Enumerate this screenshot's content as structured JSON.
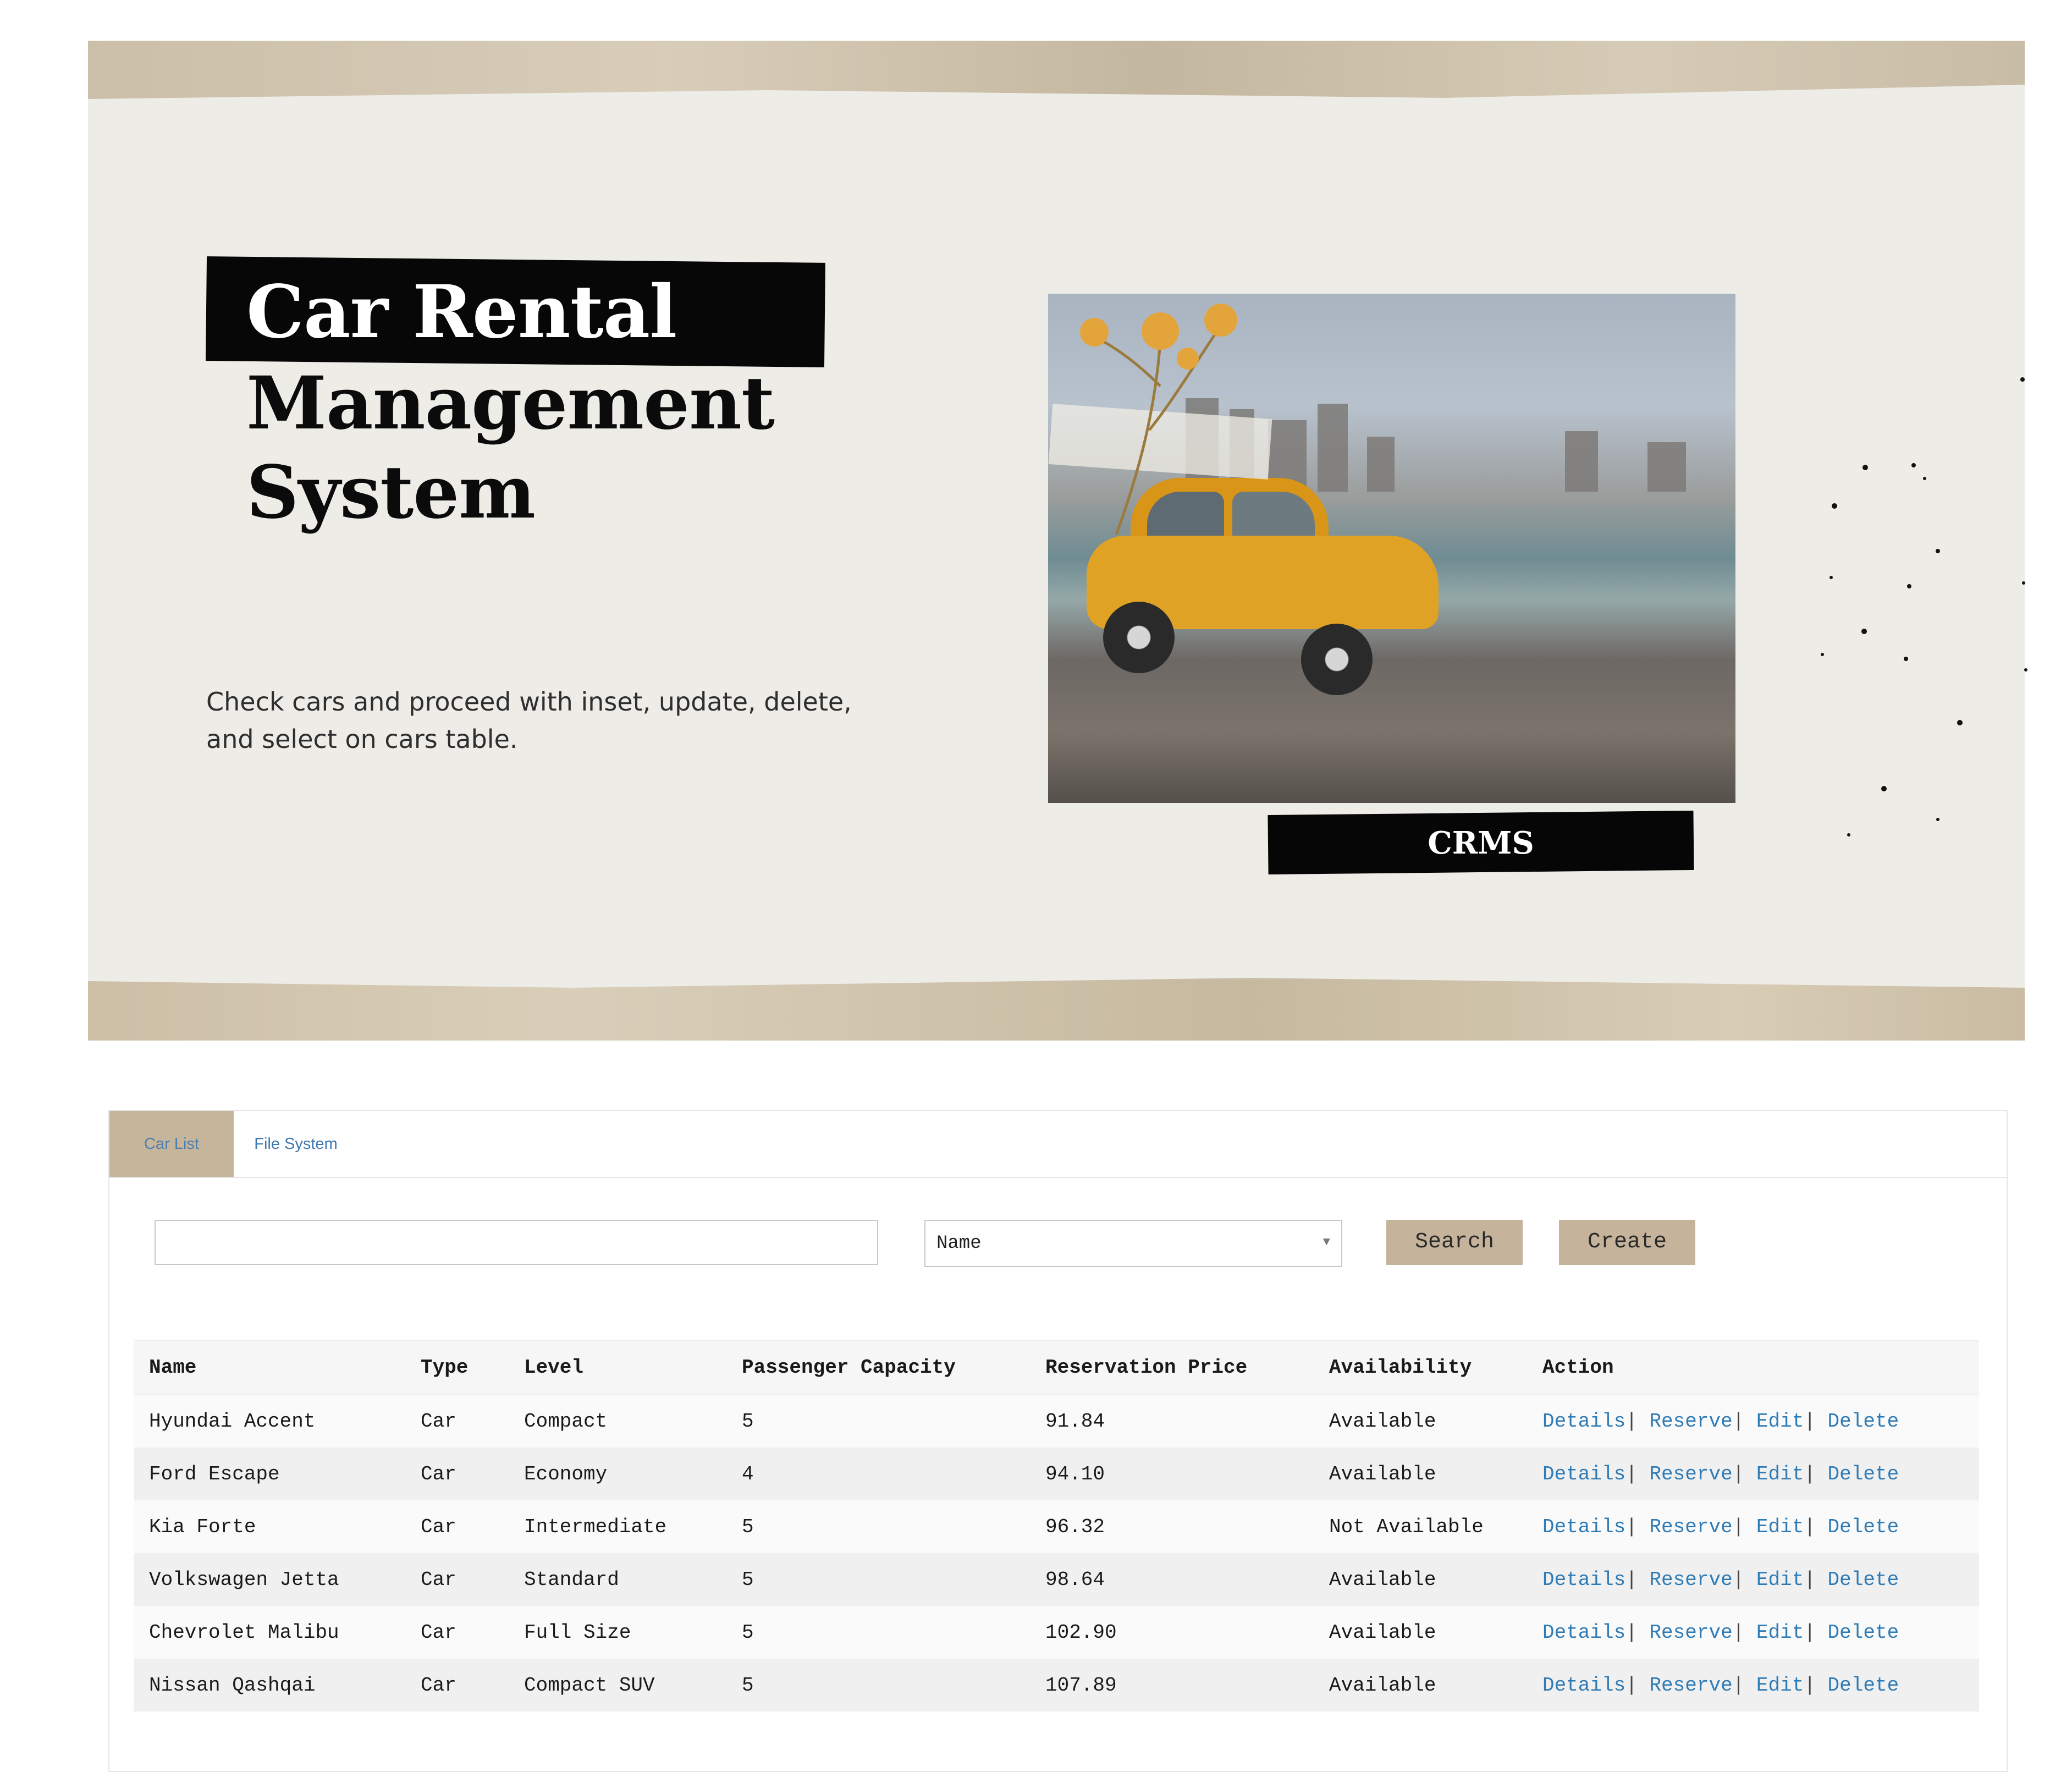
{
  "hero": {
    "title_line1": "Car Rental",
    "title_line2": "Management",
    "title_line3": "System",
    "subtitle": "Check cars and proceed with inset, update, delete, and select on cars table.",
    "badge": "CRMS"
  },
  "tabs": [
    {
      "label": "Car List",
      "active": true
    },
    {
      "label": "File System",
      "active": false
    }
  ],
  "search": {
    "value": "",
    "placeholder": ""
  },
  "filter": {
    "selected": "Name"
  },
  "buttons": {
    "search": "Search",
    "create": "Create"
  },
  "table": {
    "headers": [
      "Name",
      "Type",
      "Level",
      "Passenger Capacity",
      "Reservation Price",
      "Availability",
      "Action"
    ],
    "rows": [
      {
        "name": "Hyundai Accent",
        "type": "Car",
        "level": "Compact",
        "capacity": "5",
        "price": "91.84",
        "availability": "Available"
      },
      {
        "name": "Ford Escape",
        "type": "Car",
        "level": "Economy",
        "capacity": "4",
        "price": "94.10",
        "availability": "Available"
      },
      {
        "name": "Kia Forte",
        "type": "Car",
        "level": "Intermediate",
        "capacity": "5",
        "price": "96.32",
        "availability": "Not Available"
      },
      {
        "name": "Volkswagen Jetta",
        "type": "Car",
        "level": "Standard",
        "capacity": "5",
        "price": "98.64",
        "availability": "Available"
      },
      {
        "name": "Chevrolet Malibu",
        "type": "Car",
        "level": "Full Size",
        "capacity": "5",
        "price": "102.90",
        "availability": "Available"
      },
      {
        "name": "Nissan Qashqai",
        "type": "Car",
        "level": "Compact SUV",
        "capacity": "5",
        "price": "107.89",
        "availability": "Available"
      }
    ],
    "actions": {
      "details": "Details",
      "reserve": "Reserve",
      "edit": "Edit",
      "delete": "Delete",
      "separator": "|"
    }
  },
  "colors": {
    "accent": "#c5b49b",
    "link": "#2f7bb6",
    "hero_paper": "#eeece7"
  },
  "icons": [
    "dropdown-caret-icon"
  ]
}
